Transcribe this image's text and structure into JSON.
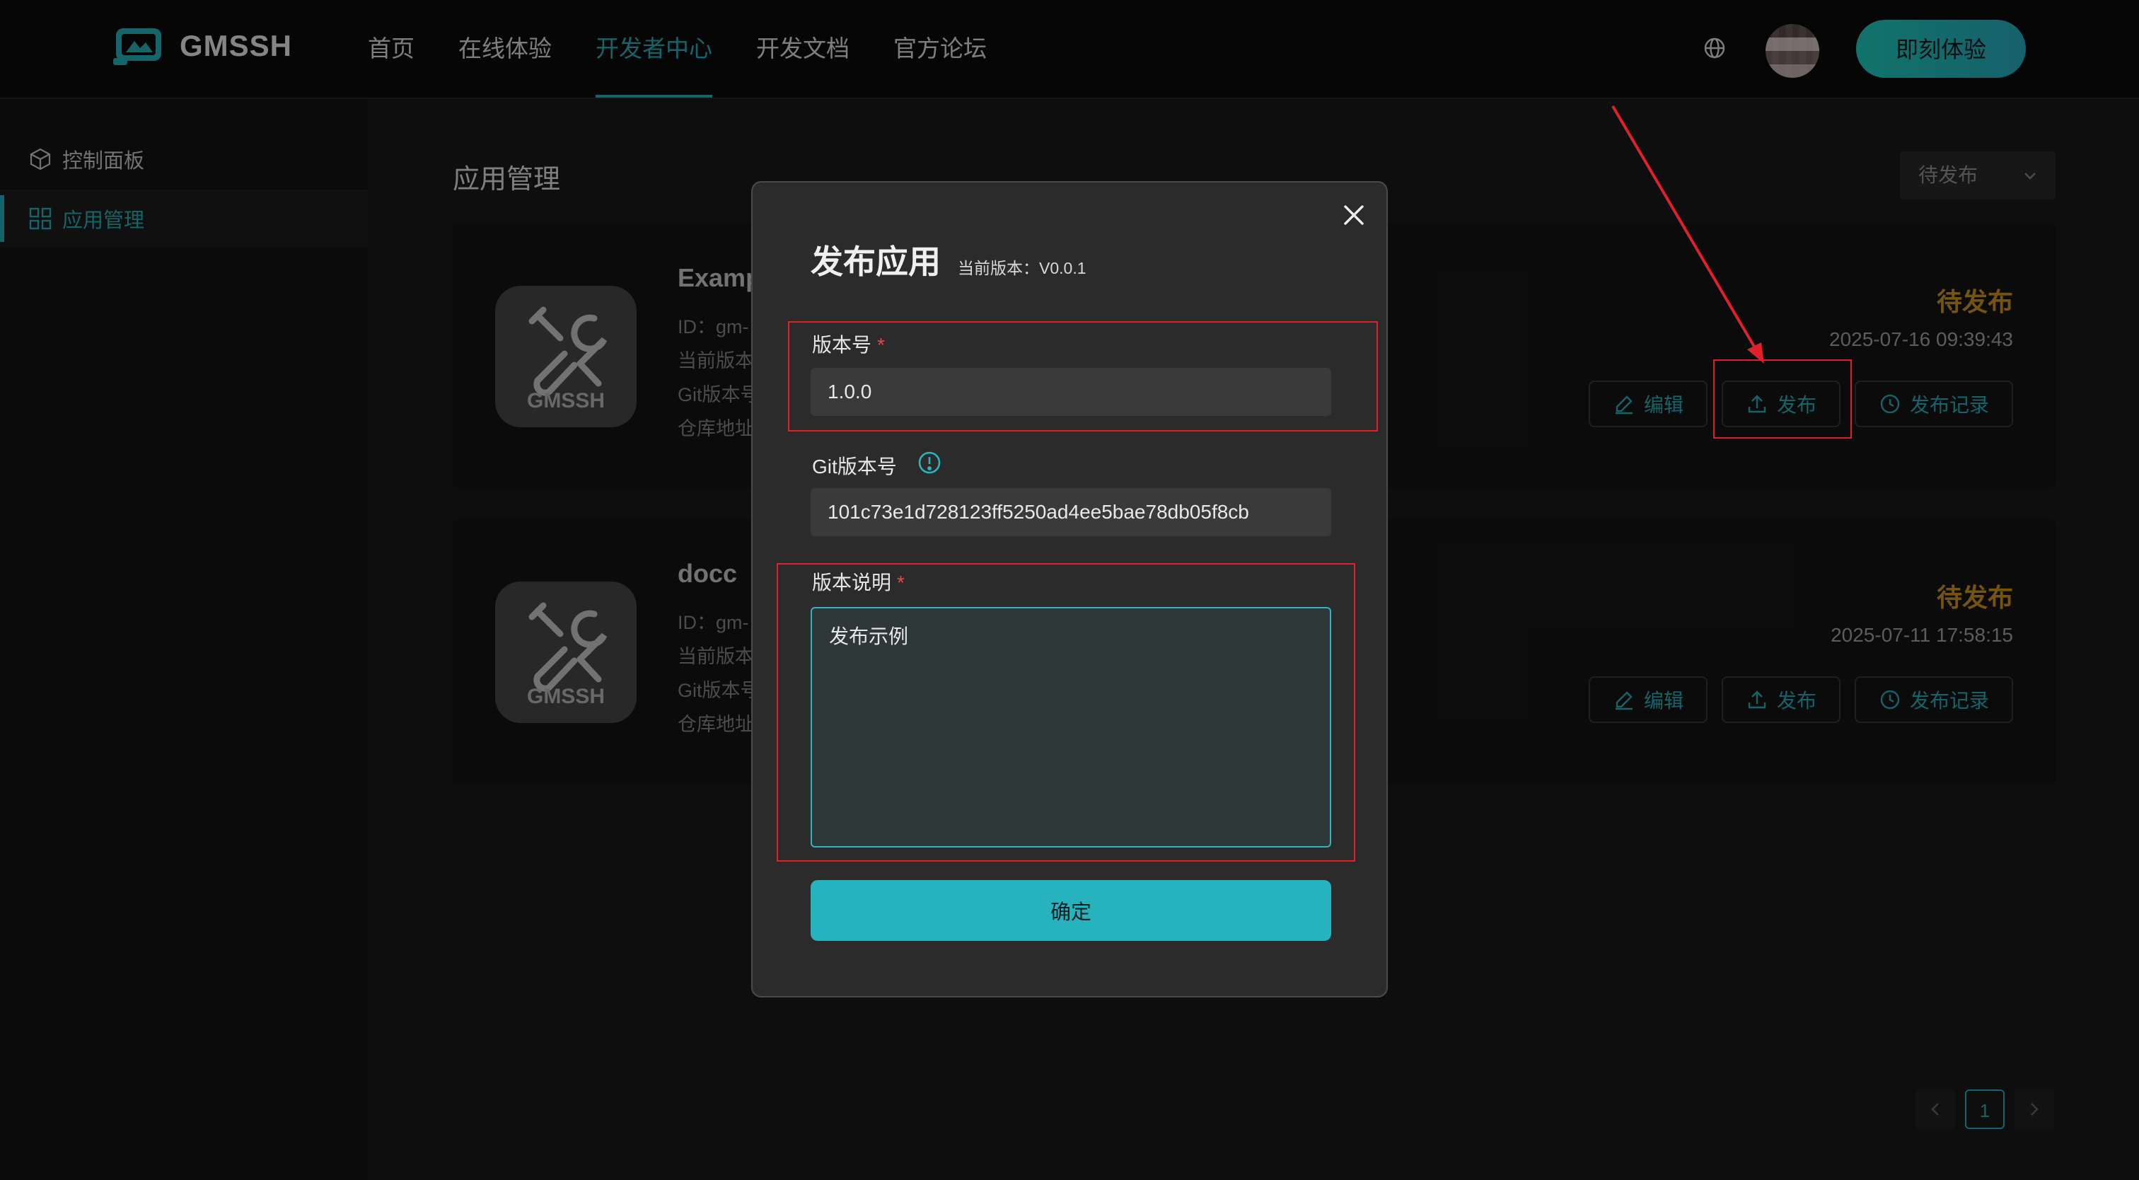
{
  "header": {
    "logo_text": "GMSSH",
    "nav": [
      "首页",
      "在线体验",
      "开发者中心",
      "开发文档",
      "官方论坛"
    ],
    "active_nav": 2,
    "cta_label": "即刻体验"
  },
  "sidebar": {
    "items": [
      {
        "label": "控制面板",
        "icon": "cube-icon"
      },
      {
        "label": "应用管理",
        "icon": "grid-icon"
      }
    ],
    "active": 1
  },
  "main": {
    "title": "应用管理",
    "filter_value": "待发布",
    "apps": [
      {
        "name": "Examp",
        "id": "ID：gm-",
        "current_version": "当前版本",
        "git_version": "Git版本号",
        "repo": "仓库地址",
        "status": "待发布",
        "date": "2025-07-16 09:39:43",
        "icon_text": "GMSSH"
      },
      {
        "name": "docc",
        "id": "ID：gm-",
        "current_version": "当前版本",
        "git_version": "Git版本号",
        "repo": "仓库地址",
        "status": "待发布",
        "date": "2025-07-11 17:58:15",
        "icon_text": "GMSSH"
      }
    ],
    "buttons": {
      "edit": "编辑",
      "publish": "发布",
      "log": "发布记录"
    },
    "pagination": {
      "current": "1"
    }
  },
  "modal": {
    "title": "发布应用",
    "current_version": "当前版本：V0.0.1",
    "version_label": "版本号",
    "version_value": "1.0.0",
    "git_label": "Git版本号",
    "git_value": "101c73e1d728123ff5250ad4ee5bae78db05f8cb",
    "desc_label": "版本说明",
    "desc_value": "发布示例",
    "required_mark": "*",
    "confirm_label": "确定"
  },
  "colors": {
    "accent": "#27b6bf",
    "status": "#d49a1c",
    "highlight": "#e0202a"
  }
}
